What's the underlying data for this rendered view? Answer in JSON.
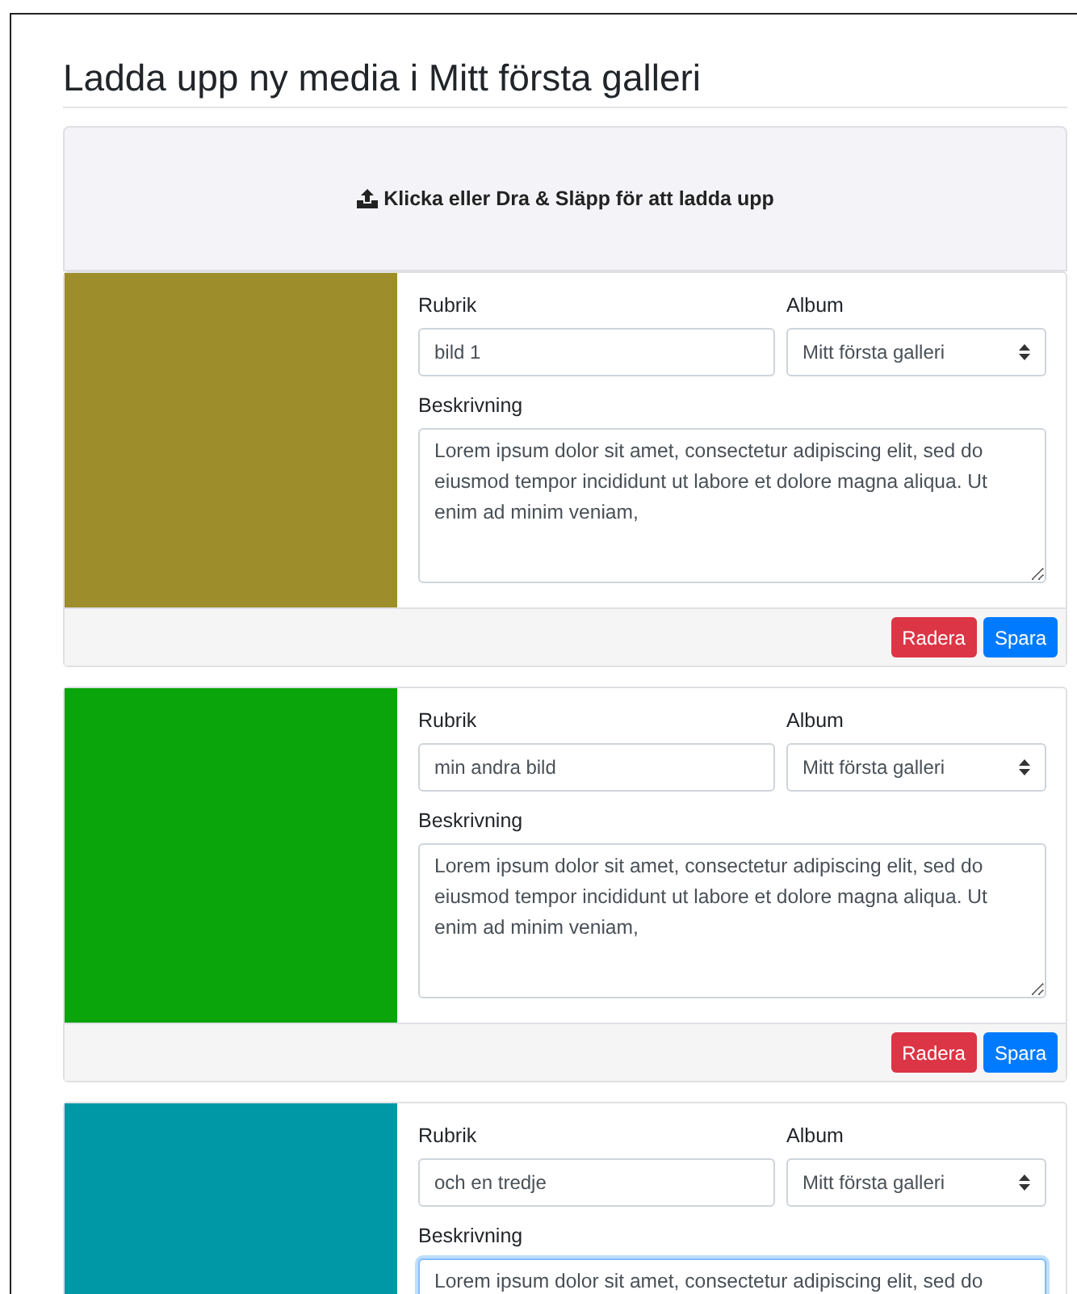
{
  "heading": "Ladda upp ny media i Mitt första galleri",
  "dropzone": {
    "label": "Klicka eller Dra & Släpp för att ladda upp"
  },
  "media": [
    {
      "color": "#9e8d2b",
      "title_label": "Rubrik",
      "title": "bild 1",
      "album_label": "Album",
      "album": "Mitt första galleri",
      "description_label": "Beskrivning",
      "description": "Lorem ipsum dolor sit amet, consectetur adipiscing elit, sed do eiusmod tempor incididunt ut labore et dolore magna aliqua. Ut enim ad minim veniam,",
      "focused": false,
      "buttons": [
        "Radera",
        "Spara"
      ]
    },
    {
      "color": "#0aa50a",
      "title_label": "Rubrik",
      "title": "min andra bild",
      "album_label": "Album",
      "album": "Mitt första galleri",
      "description_label": "Beskrivning",
      "description": "Lorem ipsum dolor sit amet, consectetur adipiscing elit, sed do eiusmod tempor incididunt ut labore et dolore magna aliqua. Ut enim ad minim veniam,",
      "focused": false,
      "buttons": [
        "Radera",
        "Spara"
      ]
    },
    {
      "color": "#0098a6",
      "title_label": "Rubrik",
      "title": "och en tredje",
      "album_label": "Album",
      "album": "Mitt första galleri",
      "description_label": "Beskrivning",
      "description": "Lorem ipsum dolor sit amet, consectetur adipiscing elit, sed do",
      "focused": true
    }
  ]
}
